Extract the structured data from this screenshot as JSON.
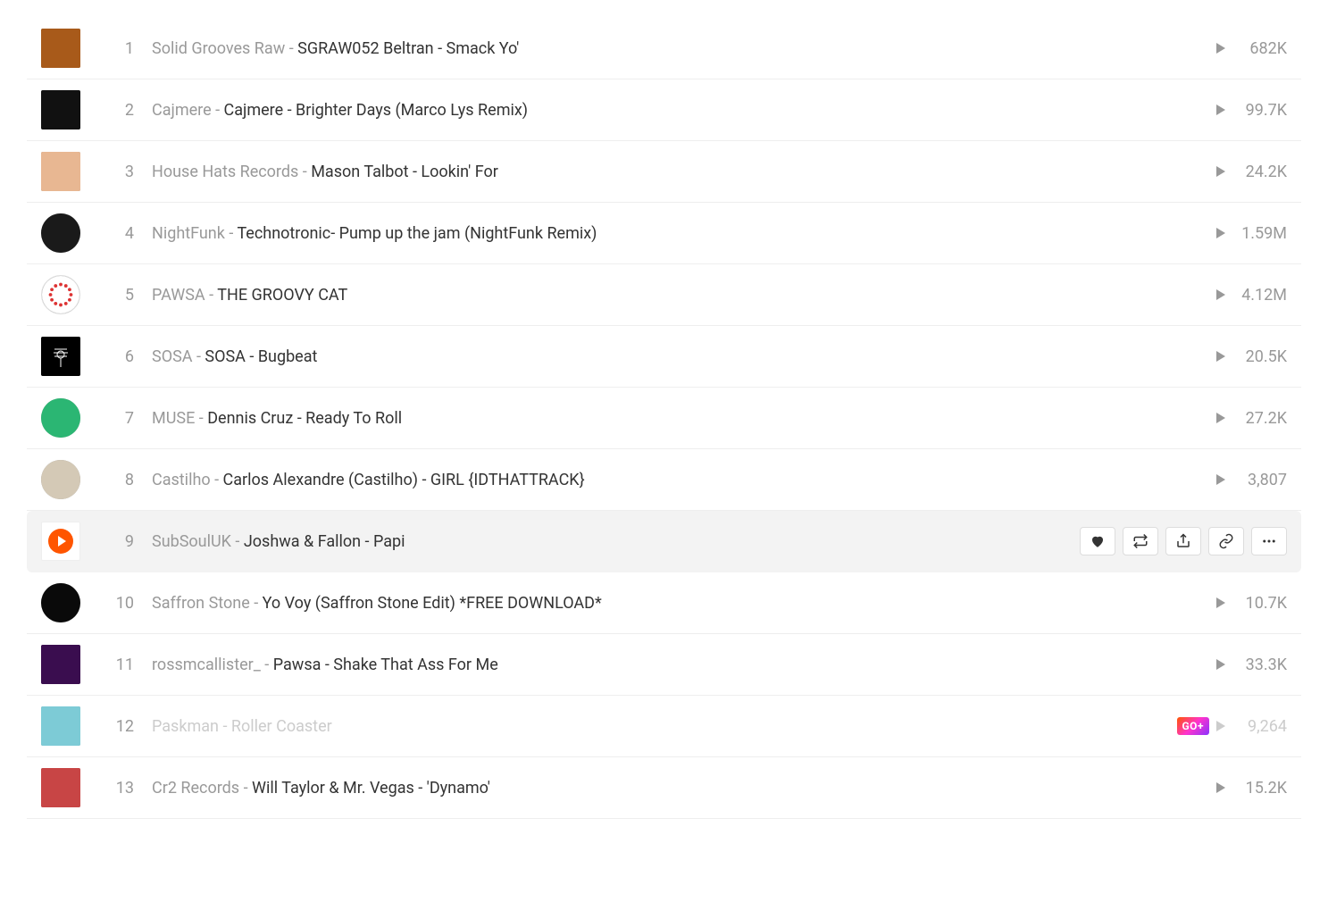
{
  "tracks": [
    {
      "rank": "1",
      "artist": "Solid Grooves Raw",
      "title": "SGRAW052 Beltran - Smack Yo'",
      "plays": "682K",
      "hovered": false,
      "dimmed": false,
      "badge": "",
      "art": {
        "shape": "square",
        "bg": "#a85a1a"
      }
    },
    {
      "rank": "2",
      "artist": "Cajmere",
      "title": "Cajmere - Brighter Days (Marco Lys Remix)",
      "plays": "99.7K",
      "hovered": false,
      "dimmed": false,
      "badge": "",
      "art": {
        "shape": "square",
        "bg": "#111"
      }
    },
    {
      "rank": "3",
      "artist": "House Hats Records",
      "title": "Mason Talbot - Lookin' For",
      "plays": "24.2K",
      "hovered": false,
      "dimmed": false,
      "badge": "",
      "art": {
        "shape": "square",
        "bg": "#e8b792"
      }
    },
    {
      "rank": "4",
      "artist": "NightFunk",
      "title": "Technotronic- Pump up the jam (NightFunk Remix)",
      "plays": "1.59M",
      "hovered": false,
      "dimmed": false,
      "badge": "",
      "art": {
        "shape": "round",
        "bg": "#1a1a1a"
      }
    },
    {
      "rank": "5",
      "artist": "PAWSA",
      "title": "THE GROOVY CAT",
      "plays": "4.12M",
      "hovered": false,
      "dimmed": false,
      "badge": "",
      "art": {
        "shape": "round",
        "bg": "#fff",
        "border": "#ddd",
        "dots": true
      }
    },
    {
      "rank": "6",
      "artist": "SOSA",
      "title": "SOSA - Bugbeat",
      "plays": "20.5K",
      "hovered": false,
      "dimmed": false,
      "badge": "",
      "art": {
        "shape": "square",
        "bg": "#000",
        "spider": true
      }
    },
    {
      "rank": "7",
      "artist": "MUSE",
      "title": "Dennis Cruz - Ready To Roll",
      "plays": "27.2K",
      "hovered": false,
      "dimmed": false,
      "badge": "",
      "art": {
        "shape": "round",
        "bg": "#2bb673"
      }
    },
    {
      "rank": "8",
      "artist": "Castilho",
      "title": "Carlos Alexandre (Castilho) - GIRL {IDTHATTRACK}",
      "plays": "3,807",
      "hovered": false,
      "dimmed": false,
      "badge": "",
      "art": {
        "shape": "round",
        "bg": "#d4c9b6"
      }
    },
    {
      "rank": "9",
      "artist": "SubSoulUK",
      "title": "Joshwa & Fallon - Papi",
      "plays": "",
      "hovered": true,
      "dimmed": false,
      "badge": "",
      "art": {
        "shape": "square",
        "bg": "#fff",
        "border": "#eee",
        "playoverlay": true
      }
    },
    {
      "rank": "10",
      "artist": "Saffron Stone",
      "title": "Yo Voy (Saffron Stone Edit) *FREE DOWNLOAD*",
      "plays": "10.7K",
      "hovered": false,
      "dimmed": false,
      "badge": "",
      "art": {
        "shape": "round",
        "bg": "#0a0a0a"
      }
    },
    {
      "rank": "11",
      "artist": "rossmcallister_",
      "title": "Pawsa - Shake That Ass For Me",
      "plays": "33.3K",
      "hovered": false,
      "dimmed": false,
      "badge": "",
      "art": {
        "shape": "square",
        "bg": "#3a0d4f"
      }
    },
    {
      "rank": "12",
      "artist": "Paskman",
      "title": "Roller Coaster",
      "plays": "9,264",
      "hovered": false,
      "dimmed": true,
      "badge": "GO+",
      "art": {
        "shape": "square",
        "bg": "#7dcbd6"
      }
    },
    {
      "rank": "13",
      "artist": "Cr2 Records",
      "title": "Will Taylor & Mr. Vegas - 'Dynamo'",
      "plays": "15.2K",
      "hovered": false,
      "dimmed": false,
      "badge": "",
      "art": {
        "shape": "square",
        "bg": "#c84545"
      }
    }
  ],
  "actions": {
    "like": "like-icon",
    "repost": "repost-icon",
    "share": "share-icon",
    "copy_link": "copy-link-icon",
    "more": "more-icon"
  }
}
